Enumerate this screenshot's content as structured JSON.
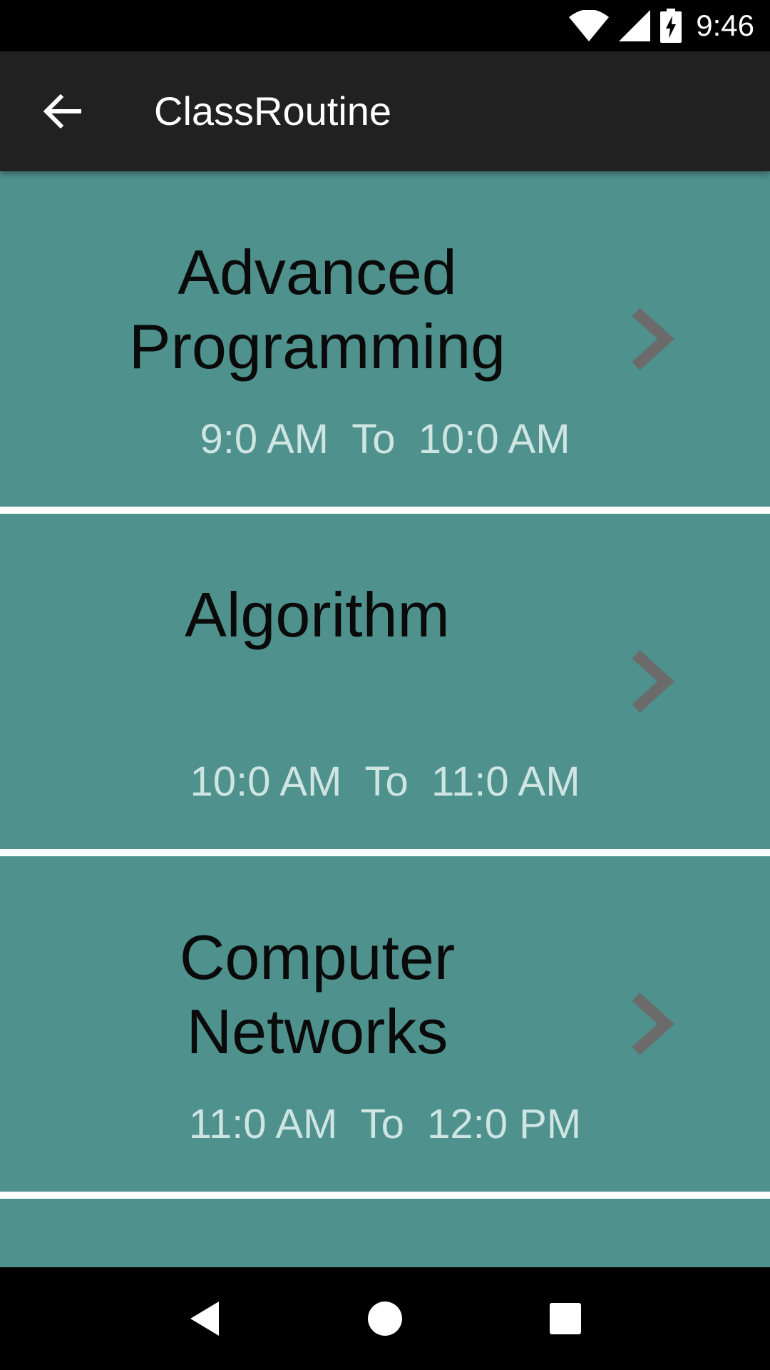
{
  "status_bar": {
    "time": "9:46",
    "icons": [
      "wifi-icon",
      "cell-signal-icon",
      "battery-charging-icon"
    ]
  },
  "app_bar": {
    "title": "ClassRoutine",
    "back_icon": "arrow-back-icon"
  },
  "colors": {
    "card_background": "#4f918d",
    "subject_text": "#0a0a0a",
    "time_text": "#cfe5e2",
    "chevron": "#6b6b6b",
    "app_bar": "#212121"
  },
  "classes": [
    {
      "subject": "Advanced Programming",
      "start": "9:0 AM",
      "separator": "To",
      "end": "10:0 AM",
      "icon": "chevron-right-icon"
    },
    {
      "subject": "Algorithm",
      "start": "10:0 AM",
      "separator": "To",
      "end": "11:0 AM",
      "icon": "chevron-right-icon"
    },
    {
      "subject": "Computer Networks",
      "start": "11:0 AM",
      "separator": "To",
      "end": "12:0 PM",
      "icon": "chevron-right-icon"
    }
  ],
  "nav_bar": {
    "icons": [
      "back-triangle-icon",
      "home-circle-icon",
      "recents-square-icon"
    ]
  }
}
